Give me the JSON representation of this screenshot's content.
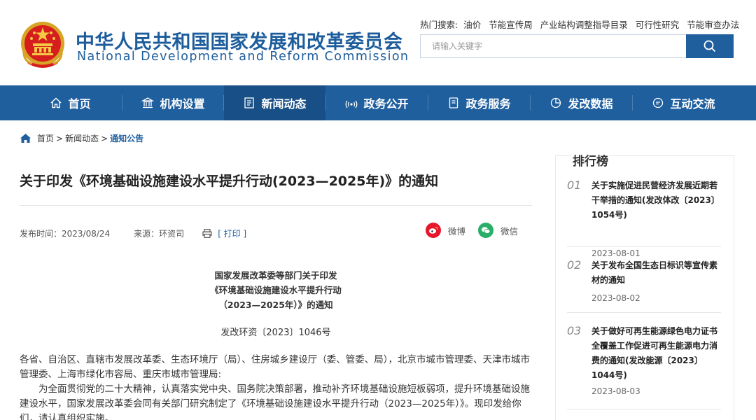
{
  "header": {
    "title_cn": "中华人民共和国国家发展和改革委员会",
    "title_en": "National Development and Reform Commission",
    "hot_search": {
      "label": "热门搜索:",
      "items": [
        "油价",
        "节能宣传周",
        "产业结构调整指导目录",
        "可行性研究",
        "节能审查办法"
      ]
    },
    "search": {
      "placeholder": "请输入关键字"
    }
  },
  "nav": {
    "items": [
      {
        "label": "首页",
        "icon": "home-icon"
      },
      {
        "label": "机构设置",
        "icon": "building-icon"
      },
      {
        "label": "新闻动态",
        "icon": "news-icon",
        "active": true
      },
      {
        "label": "政务公开",
        "icon": "broadcast-icon"
      },
      {
        "label": "政务服务",
        "icon": "document-icon"
      },
      {
        "label": "发改数据",
        "icon": "pie-chart-icon"
      },
      {
        "label": "互动交流",
        "icon": "chat-icon"
      }
    ]
  },
  "breadcrumb": {
    "items": [
      "首页",
      "新闻动态",
      "通知公告"
    ],
    "separator": ">"
  },
  "article": {
    "title": "关于印发《环境基础设施建设水平提升行动(2023—2025年)》的通知",
    "publish_time": "发布时间：2023/08/24",
    "source": "来源：环资司",
    "print": "[ 打印 ]",
    "share_weibo": "微博",
    "share_wechat": "微信",
    "doc_head": [
      "国家发展改革委等部门关于印发",
      "《环境基础设施建设水平提升行动",
      "（2023—2025年）》的通知"
    ],
    "doc_number": "发改环资〔2023〕1046号",
    "recipients": "各省、自治区、直辖市发展改革委、生态环境厅（局）、住房城乡建设厅（委、管委、局），北京市城市管理委、天津市城市管理委、上海市绿化市容局、重庆市城市管理局:",
    "paragraph1": "为全面贯彻党的二十大精神，认真落实党中央、国务院决策部署，推动补齐环境基础设施短板弱项，提升环境基础设施建设水平，国家发展改革委会同有关部门研究制定了《环境基础设施建设水平提升行动（2023—2025年）》。现印发给你们，请认真组织实施。"
  },
  "sidebar": {
    "title": "排行榜",
    "items": [
      {
        "num": "01",
        "title": "关于实施促进民营经济发展近期若干举措的通知(发改体改〔2023〕1054号)",
        "date": "2023-08-01"
      },
      {
        "num": "02",
        "title": "关于发布全国生态日标识等宣传素材的通知",
        "date": "2023-08-02"
      },
      {
        "num": "03",
        "title": "关于做好可再生能源绿色电力证书全覆盖工作促进可再生能源电力消费的通知(发改能源〔2023〕1044号)",
        "date": "2023-08-03"
      }
    ]
  },
  "colors": {
    "brand_blue": "#1f5f9e",
    "nav_active": "#184f87",
    "weibo_red": "#e6162d",
    "wechat_green": "#2aae67"
  }
}
